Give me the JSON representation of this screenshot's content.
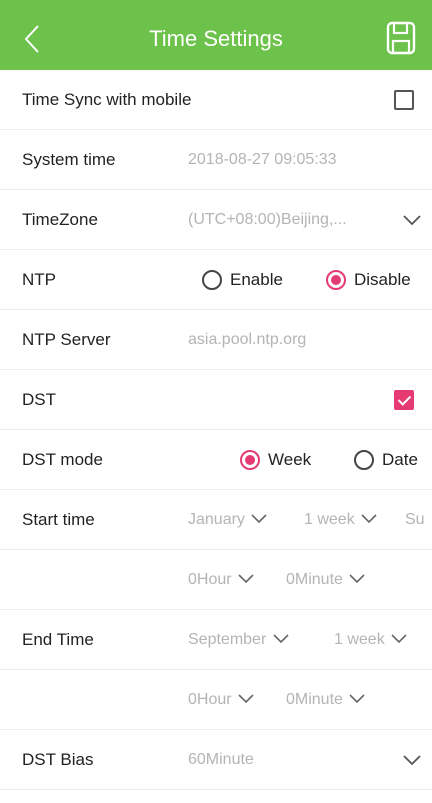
{
  "header": {
    "title": "Time Settings",
    "back_icon": "chevron-left-icon",
    "save_icon": "floppy-disk-icon"
  },
  "accent_color": "#6cc24a",
  "check_color": "#e63a73",
  "rows": {
    "time_sync": {
      "label": "Time Sync with mobile",
      "checked": false
    },
    "system_time": {
      "label": "System time",
      "value": "2018-08-27 09:05:33"
    },
    "timezone": {
      "label": "TimeZone",
      "value": "(UTC+08:00)Beijing,..."
    },
    "ntp": {
      "label": "NTP",
      "options": [
        "Enable",
        "Disable"
      ],
      "selected": "Disable"
    },
    "ntp_server": {
      "label": "NTP Server",
      "value": "asia.pool.ntp.org"
    },
    "dst": {
      "label": "DST",
      "checked": true
    },
    "dst_mode": {
      "label": "DST mode",
      "options": [
        "Week",
        "Date"
      ],
      "selected": "Week"
    },
    "start_time": {
      "label": "Start time",
      "month": "January",
      "week": "1 week",
      "day": "Su",
      "hour": "0Hour",
      "minute": "0Minute"
    },
    "end_time": {
      "label": "End Time",
      "month": "September",
      "week": "1 week",
      "hour": "0Hour",
      "minute": "0Minute"
    },
    "dst_bias": {
      "label": "DST Bias",
      "value": "60Minute"
    }
  }
}
